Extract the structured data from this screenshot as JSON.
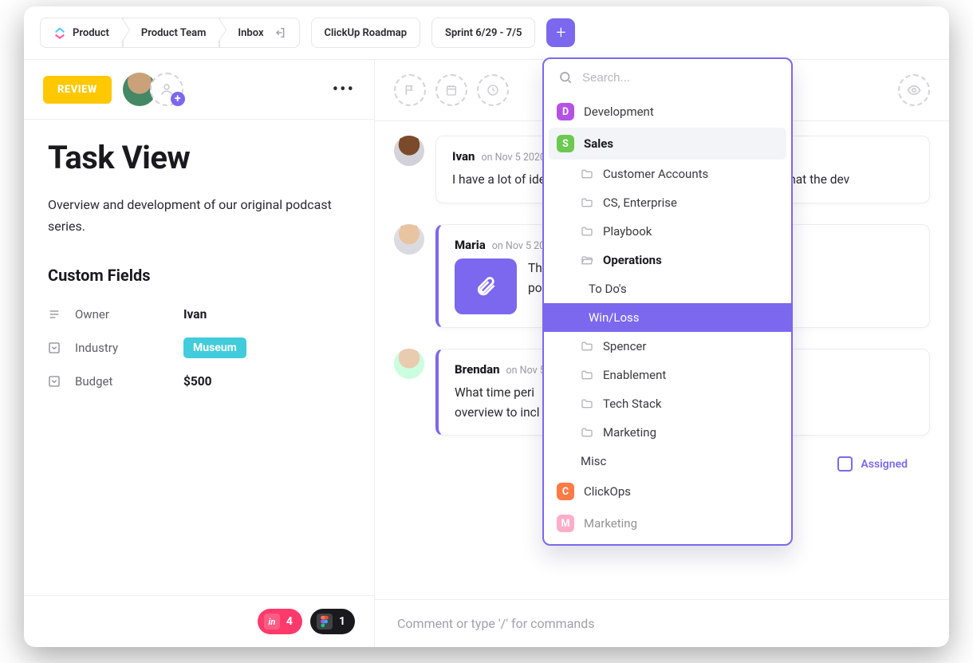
{
  "breadcrumbs": {
    "items": [
      "Product",
      "Product Team",
      "Inbox",
      "ClickUp Roadmap",
      "Sprint 6/29 - 7/5"
    ]
  },
  "left": {
    "status": "REVIEW",
    "title": "Task View",
    "description": "Overview and development of our original podcast series.",
    "custom_fields_heading": "Custom Fields",
    "fields": [
      {
        "icon": "person-icon",
        "label": "Owner",
        "value": "Ivan",
        "type": "text"
      },
      {
        "icon": "dropdown-icon",
        "label": "Industry",
        "value": "Museum",
        "type": "tag"
      },
      {
        "icon": "dropdown-icon",
        "label": "Budget",
        "value": "$500",
        "type": "text"
      }
    ],
    "footer_chips": [
      {
        "style": "pink",
        "icon": "in",
        "count": "4"
      },
      {
        "style": "dark",
        "icon": "figma",
        "count": "1"
      }
    ]
  },
  "right": {
    "comments": [
      {
        "author": "Ivan",
        "date": "on Nov 5 2020",
        "body": "I have a lot of ideas floating around, is there somewhere for what the dev",
        "accent": false,
        "attachment": false
      },
      {
        "author": "Maria",
        "date": "on Nov 5 20",
        "body": "This ... first po...",
        "accent": true,
        "attachment": true
      },
      {
        "author": "Brendan",
        "date": "on Nov 5",
        "body": "What time period ... update overview to incl",
        "accent": true,
        "attachment": false
      }
    ],
    "assigned_label": "Assigned",
    "comment_placeholder": "Comment or type '/' for commands"
  },
  "dropdown": {
    "search_placeholder": "Search...",
    "items": [
      {
        "level": 0,
        "type": "square",
        "color": "#b552e6",
        "letter": "D",
        "label": "Development"
      },
      {
        "level": 0,
        "type": "square",
        "color": "#6bc950",
        "letter": "S",
        "label": "Sales",
        "highlight": true
      },
      {
        "level": 1,
        "type": "folder",
        "label": "Customer Accounts"
      },
      {
        "level": 1,
        "type": "folder",
        "label": "CS, Enterprise"
      },
      {
        "level": 1,
        "type": "folder",
        "label": "Playbook"
      },
      {
        "level": 1,
        "type": "folder-open",
        "label": "Operations",
        "bold": true
      },
      {
        "level": 2,
        "type": "none",
        "label": "To Do's"
      },
      {
        "level": 2,
        "type": "none",
        "label": "Win/Loss",
        "selected": true
      },
      {
        "level": 1,
        "type": "folder",
        "label": "Spencer"
      },
      {
        "level": 1,
        "type": "folder",
        "label": "Enablement"
      },
      {
        "level": 1,
        "type": "folder",
        "label": "Tech Stack"
      },
      {
        "level": 1,
        "type": "folder",
        "label": "Marketing"
      },
      {
        "level": 1,
        "type": "none",
        "label": "Misc"
      },
      {
        "level": 0,
        "type": "square",
        "color": "#ff7a45",
        "letter": "C",
        "label": "ClickOps"
      },
      {
        "level": 0,
        "type": "square",
        "color": "#ff6b9d",
        "letter": "M",
        "label": "Marketing",
        "faded": true
      }
    ]
  }
}
